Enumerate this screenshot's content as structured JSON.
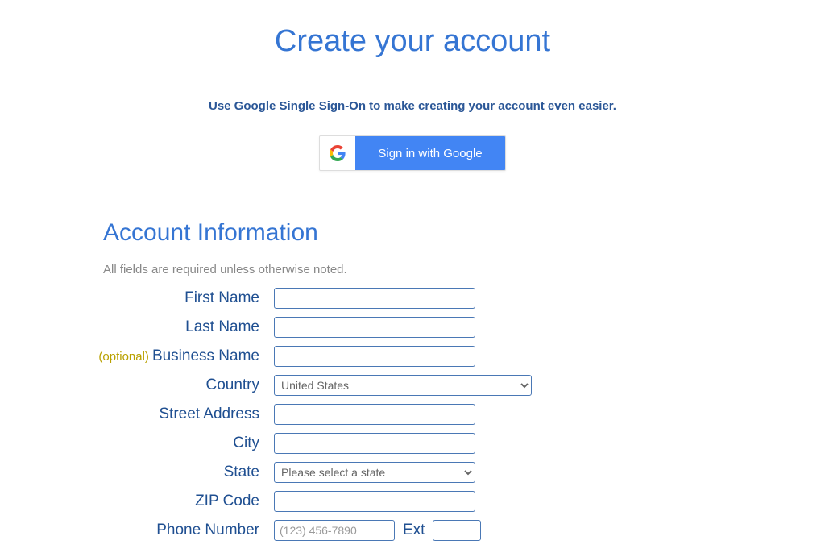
{
  "title": "Create your account",
  "sso_text": "Use Google Single Sign-On to make creating your account even easier.",
  "google_btn": "Sign in with Google",
  "section_title": "Account Information",
  "required_note": "All fields are required unless otherwise noted.",
  "optional_tag": "(optional)",
  "labels": {
    "first_name": "First Name",
    "last_name": "Last Name",
    "business_name": "Business Name",
    "country": "Country",
    "street": "Street Address",
    "city": "City",
    "state": "State",
    "zip": "ZIP Code",
    "phone": "Phone Number",
    "ext": "Ext"
  },
  "values": {
    "country": "United States",
    "state": "Please select a state"
  },
  "placeholders": {
    "phone": "(123) 456-7890"
  }
}
